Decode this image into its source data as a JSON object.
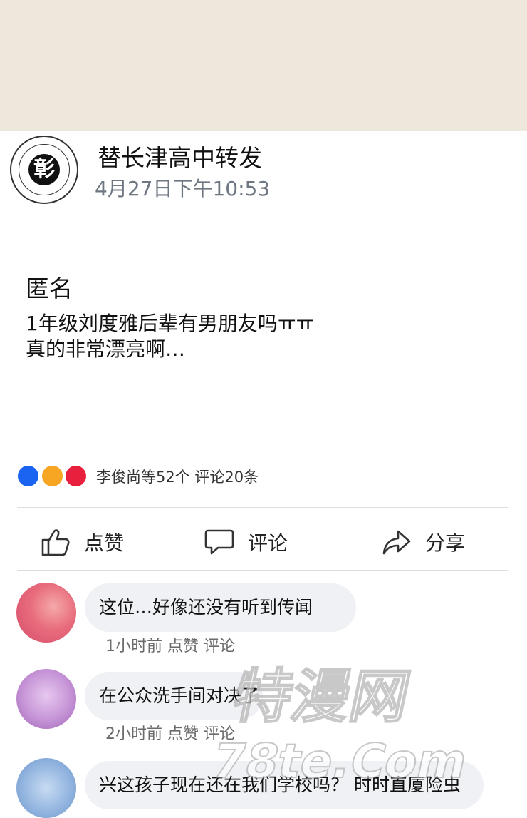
{
  "post": {
    "author": "替长津高中转发",
    "timestamp": "4月27日下午10:53",
    "label": "匿名",
    "lines": [
      "1年级刘度雅后辈有男朋友吗ㅠㅠ",
      "真的非常漂亮啊…"
    ],
    "avatar_glyph": "彰"
  },
  "reactions": {
    "summary": "李俊尚等52个 评论20条",
    "colors": [
      "#1b64f1",
      "#f6a623",
      "#e81f3d"
    ]
  },
  "actions": {
    "like": {
      "label": "点赞",
      "icon": "thumbs-up-icon"
    },
    "comment": {
      "label": "评论",
      "icon": "speech-bubble-icon"
    },
    "share": {
      "label": "分享",
      "icon": "share-arrow-icon"
    }
  },
  "comments": [
    {
      "text": "这位…好像还没有听到传闻",
      "time": "1小时前",
      "like": "点赞",
      "reply": "评论"
    },
    {
      "text": "在公众洗手间对决了",
      "time": "2小时前",
      "like": "点赞",
      "reply": "评论"
    },
    {
      "text": "兴这孩子现在还在我们学校吗？ 时时直厦险虫"
    }
  ],
  "watermark": {
    "line1": "特漫网",
    "line2": "78te.Com"
  },
  "colors": {
    "top_band": "#ede7dc",
    "bubble": "#eff1f4",
    "meta_text": "#6b6b6b",
    "timestamp": "#6d7681"
  }
}
